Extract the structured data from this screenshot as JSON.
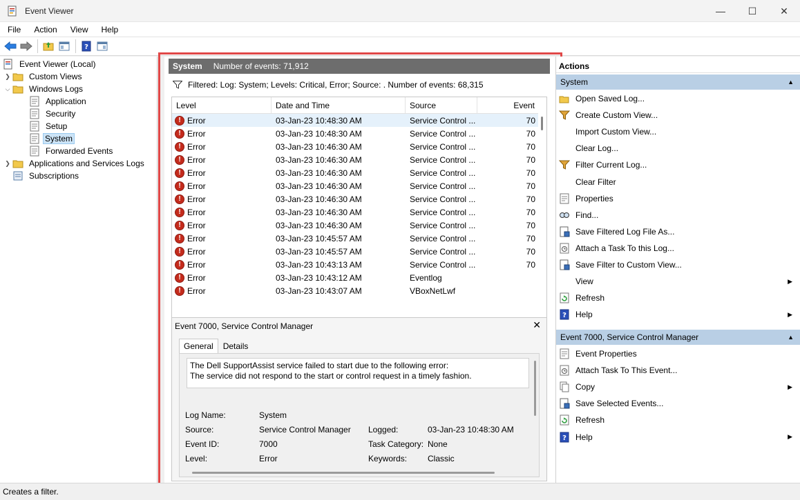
{
  "window": {
    "title": "Event Viewer",
    "minimize": "—",
    "maximize": "☐",
    "close": "✕"
  },
  "menu": [
    "File",
    "Action",
    "View",
    "Help"
  ],
  "tree": {
    "root": "Event Viewer (Local)",
    "custom_views": "Custom Views",
    "windows_logs": "Windows Logs",
    "application": "Application",
    "security": "Security",
    "setup": "Setup",
    "system": "System",
    "forwarded": "Forwarded Events",
    "apps_services": "Applications and Services Logs",
    "subscriptions": "Subscriptions"
  },
  "center": {
    "log_name": "System",
    "event_count": "Number of events: 71,912",
    "filter_text": "Filtered: Log: System; Levels: Critical, Error; Source: . Number of events: 68,315",
    "columns": [
      "Level",
      "Date and Time",
      "Source",
      "Event"
    ],
    "rows": [
      {
        "level": "Error",
        "date": "03-Jan-23 10:48:30 AM",
        "source": "Service Control ...",
        "event": "70"
      },
      {
        "level": "Error",
        "date": "03-Jan-23 10:48:30 AM",
        "source": "Service Control ...",
        "event": "70"
      },
      {
        "level": "Error",
        "date": "03-Jan-23 10:46:30 AM",
        "source": "Service Control ...",
        "event": "70"
      },
      {
        "level": "Error",
        "date": "03-Jan-23 10:46:30 AM",
        "source": "Service Control ...",
        "event": "70"
      },
      {
        "level": "Error",
        "date": "03-Jan-23 10:46:30 AM",
        "source": "Service Control ...",
        "event": "70"
      },
      {
        "level": "Error",
        "date": "03-Jan-23 10:46:30 AM",
        "source": "Service Control ...",
        "event": "70"
      },
      {
        "level": "Error",
        "date": "03-Jan-23 10:46:30 AM",
        "source": "Service Control ...",
        "event": "70"
      },
      {
        "level": "Error",
        "date": "03-Jan-23 10:46:30 AM",
        "source": "Service Control ...",
        "event": "70"
      },
      {
        "level": "Error",
        "date": "03-Jan-23 10:46:30 AM",
        "source": "Service Control ...",
        "event": "70"
      },
      {
        "level": "Error",
        "date": "03-Jan-23 10:45:57 AM",
        "source": "Service Control ...",
        "event": "70"
      },
      {
        "level": "Error",
        "date": "03-Jan-23 10:45:57 AM",
        "source": "Service Control ...",
        "event": "70"
      },
      {
        "level": "Error",
        "date": "03-Jan-23 10:43:13 AM",
        "source": "Service Control ...",
        "event": "70"
      },
      {
        "level": "Error",
        "date": "03-Jan-23 10:43:12 AM",
        "source": "Eventlog",
        "event": ""
      },
      {
        "level": "Error",
        "date": "03-Jan-23 10:43:07 AM",
        "source": "VBoxNetLwf",
        "event": ""
      }
    ]
  },
  "detail": {
    "title": "Event 7000, Service Control Manager",
    "close": "✕",
    "tab_general": "General",
    "tab_details": "Details",
    "message_line1": "The Dell SupportAssist service failed to start due to the following error:",
    "message_line2": "The service did not respond to the start or control request in a timely fashion.",
    "log_name_label": "Log Name:",
    "log_name_value": "System",
    "source_label": "Source:",
    "source_value": "Service Control Manager",
    "logged_label": "Logged:",
    "logged_value": "03-Jan-23 10:48:30 AM",
    "event_id_label": "Event ID:",
    "event_id_value": "7000",
    "task_category_label": "Task Category:",
    "task_category_value": "None",
    "level_label": "Level:",
    "level_value": "Error",
    "keywords_label": "Keywords:",
    "keywords_value": "Classic"
  },
  "actions": {
    "title": "Actions",
    "section1": "System",
    "items1": [
      "Open Saved Log...",
      "Create Custom View...",
      "Import Custom View...",
      "Clear Log...",
      "Filter Current Log...",
      "Clear Filter",
      "Properties",
      "Find...",
      "Save Filtered Log File As...",
      "Attach a Task To this Log...",
      "Save Filter to Custom View...",
      "View",
      "Refresh",
      "Help"
    ],
    "section2": "Event 7000, Service Control Manager",
    "items2": [
      "Event Properties",
      "Attach Task To This Event...",
      "Copy",
      "Save Selected Events...",
      "Refresh",
      "Help"
    ]
  },
  "status": "Creates a filter.",
  "colors": {
    "accent_frame": "#e04848",
    "header_gray": "#6d6d6d",
    "section_blue": "#b9cfe5",
    "error_red": "#c42b1c"
  }
}
